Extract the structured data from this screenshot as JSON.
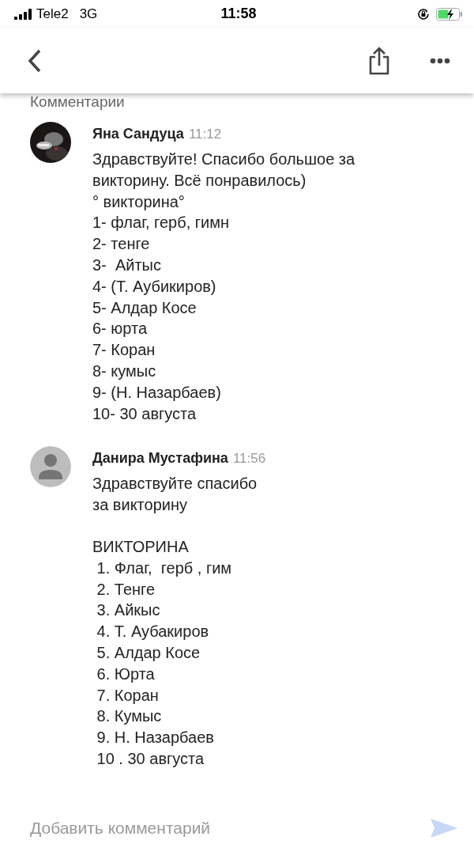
{
  "status_bar": {
    "carrier": "Tele2",
    "network": "3G",
    "time": "11:58"
  },
  "section_title": "Комментарии",
  "comments": [
    {
      "author": "Яна Сандуца",
      "time": "11:12",
      "paragraphs": [
        [
          "Здравствуйте! Спасибо большое за",
          "викторину. Всё понравилось)",
          "° викторина°",
          "1- флаг, герб, гимн",
          "2- тенге",
          "3-  Айтыс",
          "4- (Т. Аубикиров)",
          "5- Алдар Косе",
          "6- юрта",
          "7- Коран",
          "8- кумыс",
          "9- (Н. Назарбаев)",
          "10- 30 августа"
        ]
      ]
    },
    {
      "author": "Данира Мустафина",
      "time": "11:56",
      "kind": "placeholder",
      "paragraphs": [
        [
          "Здравствуйте спасибо",
          "за викторину"
        ],
        [
          "ВИКТОРИНА",
          " 1. Флаг,  герб , гим",
          " 2. Тенге",
          " 3. Айкыс",
          " 4. Т. Аубакиров",
          " 5. Алдар Косе",
          " 6. Юрта",
          " 7. Коран",
          " 8. Кумыс",
          " 9. Н. Назарбаев",
          " 10 . 30 августа"
        ]
      ]
    }
  ],
  "composer": {
    "placeholder": "Добавить комментарий"
  }
}
